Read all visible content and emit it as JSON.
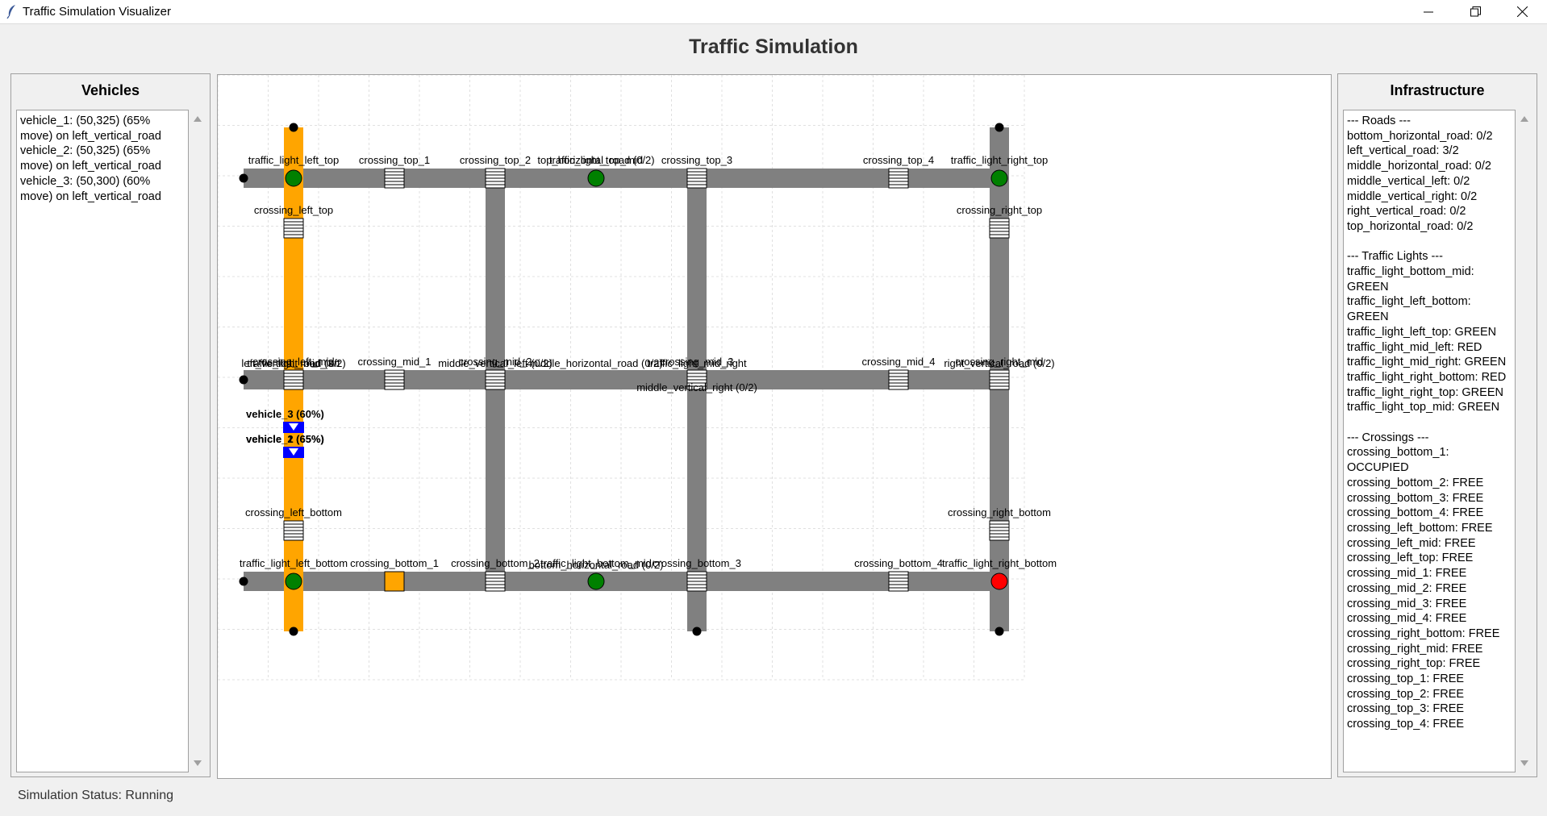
{
  "window": {
    "title": "Traffic Simulation Visualizer",
    "controls": [
      "minimize-icon",
      "restore-icon",
      "close-icon"
    ]
  },
  "header": {
    "title": "Traffic Simulation"
  },
  "vehicles_panel": {
    "title": "Vehicles",
    "lines": [
      "vehicle_1: (50,325) (65%",
      "move) on left_vertical_road",
      "vehicle_2: (50,325) (65%",
      "move) on left_vertical_road",
      "vehicle_3: (50,300) (60%",
      "move) on left_vertical_road"
    ]
  },
  "infrastructure_panel": {
    "title": "Infrastructure",
    "lines": [
      "--- Roads ---",
      "bottom_horizontal_road: 0/2",
      "left_vertical_road: 3/2",
      "middle_horizontal_road: 0/2",
      "middle_vertical_left: 0/2",
      "middle_vertical_right: 0/2",
      "right_vertical_road: 0/2",
      "top_horizontal_road: 0/2",
      "",
      "--- Traffic Lights ---",
      "traffic_light_bottom_mid:",
      "GREEN",
      "traffic_light_left_bottom:",
      "GREEN",
      "traffic_light_left_top: GREEN",
      "traffic_light_mid_left: RED",
      "traffic_light_mid_right: GREEN",
      "traffic_light_right_bottom: RED",
      "traffic_light_right_top: GREEN",
      "traffic_light_top_mid: GREEN",
      "",
      "--- Crossings ---",
      "crossing_bottom_1:",
      "OCCUPIED",
      "crossing_bottom_2: FREE",
      "crossing_bottom_3: FREE",
      "crossing_bottom_4: FREE",
      "crossing_left_bottom: FREE",
      "crossing_left_mid: FREE",
      "crossing_left_top: FREE",
      "crossing_mid_1: FREE",
      "crossing_mid_2: FREE",
      "crossing_mid_3: FREE",
      "crossing_mid_4: FREE",
      "crossing_right_bottom: FREE",
      "crossing_right_mid: FREE",
      "crossing_right_top: FREE",
      "crossing_top_1: FREE",
      "crossing_top_2: FREE",
      "crossing_top_3: FREE",
      "crossing_top_4: FREE"
    ]
  },
  "status": {
    "text": "Simulation Status: Running"
  },
  "colors": {
    "road": "#808080",
    "road_occupied": "#ffa500",
    "light_green": "#008000",
    "light_red": "#ff0000",
    "crossing_occupied": "#ffa500",
    "vehicle": "#0000ff",
    "grid": "#e0e0e0"
  },
  "map": {
    "road_labels": [
      "top_horizontal_road (0/2)",
      "left_vertical_road (3/2)",
      "middle_horizontal_road (0/2)",
      "middle_vertical_left (0/2)",
      "middle_vertical_right (0/2)",
      "right_vertical_road (0/2)",
      "bottom_horizontal_road (0/2)"
    ],
    "crossing_labels": [
      "crossing_top_1",
      "crossing_top_2",
      "crossing_top_3",
      "crossing_top_4",
      "crossing_left_top",
      "crossing_right_top",
      "crossing_left_mid",
      "crossing_mid_1",
      "crossing_mid_2",
      "crossing_mid_3",
      "crossing_mid_4",
      "crossing_right_mid",
      "crossing_left_bottom",
      "crossing_right_bottom",
      "crossing_bottom_1",
      "crossing_bottom_2",
      "crossing_bottom_3",
      "crossing_bottom_4"
    ],
    "light_labels": [
      "traffic_light_left_top",
      "traffic_light_top_mid",
      "traffic_light_right_top",
      "traffic_light_mid_left",
      "traffic_light_mid_right",
      "traffic_light_left_bottom",
      "traffic_light_bottom_mid",
      "traffic_light_right_bottom"
    ],
    "vehicle_labels": [
      "vehicle_3 (60%)",
      "vehicle_2 (65%)",
      "vehicle_1 (65%)"
    ]
  }
}
